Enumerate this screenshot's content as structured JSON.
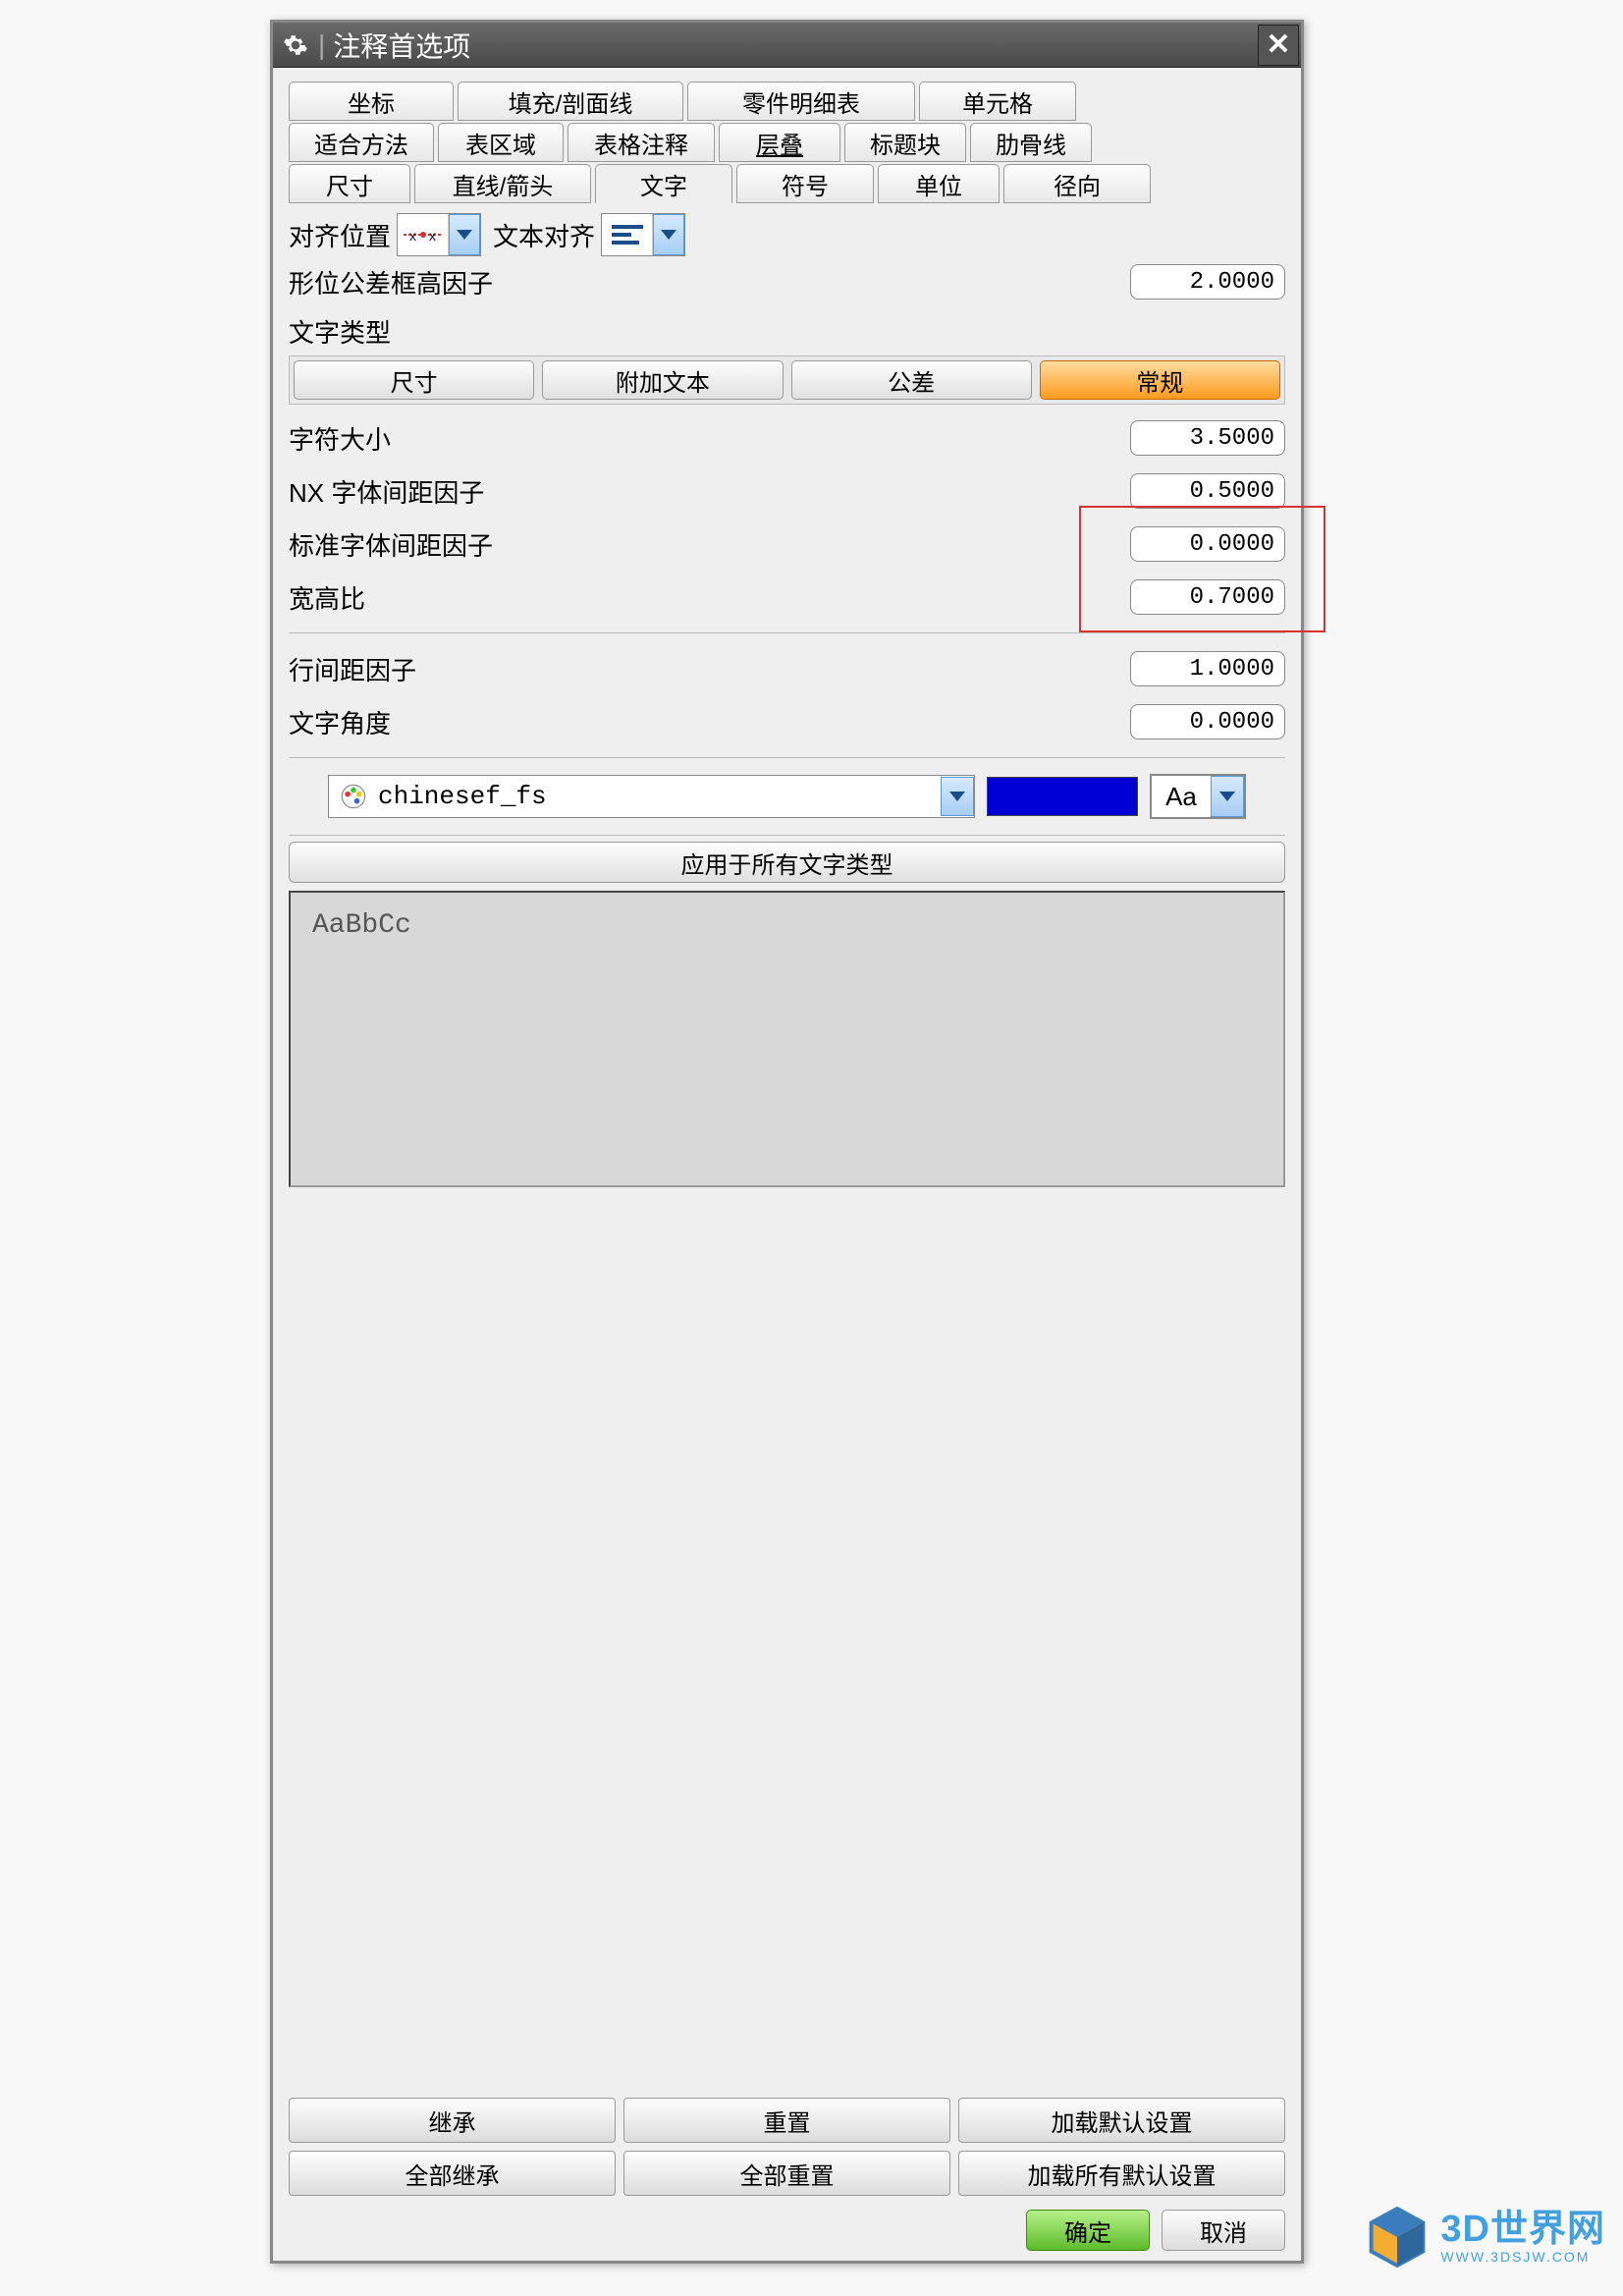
{
  "title": "注释首选项",
  "tabRows": [
    [
      {
        "id": "coord",
        "label": "坐标"
      },
      {
        "id": "fill-section",
        "label": "填充/剖面线"
      },
      {
        "id": "parts-list",
        "label": "零件明细表"
      },
      {
        "id": "cell",
        "label": "单元格"
      }
    ],
    [
      {
        "id": "fit-method",
        "label": "适合方法"
      },
      {
        "id": "table-area",
        "label": "表区域"
      },
      {
        "id": "table-annot",
        "label": "表格注释"
      },
      {
        "id": "overlay",
        "label": "层叠"
      },
      {
        "id": "title-block",
        "label": "标题块"
      },
      {
        "id": "rib-line",
        "label": "肋骨线"
      }
    ],
    [
      {
        "id": "dimension",
        "label": "尺寸"
      },
      {
        "id": "line-arrow",
        "label": "直线/箭头"
      },
      {
        "id": "text",
        "label": "文字",
        "active": true
      },
      {
        "id": "symbol",
        "label": "符号"
      },
      {
        "id": "unit",
        "label": "单位"
      },
      {
        "id": "radial",
        "label": "径向"
      }
    ]
  ],
  "alignPositionLabel": "对齐位置",
  "textAlignLabel": "文本对齐",
  "geomTolFrameLabel": "形位公差框高因子",
  "geomTolFrameValue": "2.0000",
  "textTypeLabel": "文字类型",
  "typeButtons": [
    {
      "id": "t-dimension",
      "label": "尺寸"
    },
    {
      "id": "t-appended",
      "label": "附加文本"
    },
    {
      "id": "t-tolerance",
      "label": "公差"
    },
    {
      "id": "t-general",
      "label": "常规",
      "active": true
    }
  ],
  "params": [
    {
      "id": "char-size",
      "label": "字符大小",
      "value": "3.5000"
    },
    {
      "id": "nx-spacing",
      "label": "NX 字体间距因子",
      "value": "0.5000"
    },
    {
      "id": "std-spacing",
      "label": "标准字体间距因子",
      "value": "0.0000"
    },
    {
      "id": "aspect",
      "label": "宽高比",
      "value": "0.7000"
    },
    {
      "id": "line-spacing",
      "label": "行间距因子",
      "value": "1.0000"
    },
    {
      "id": "text-angle",
      "label": "文字角度",
      "value": "0.0000"
    }
  ],
  "fontName": "chinesef_fs",
  "aaLabel": "Aa",
  "colorHex": "#0000d4",
  "applyAllLabel": "应用于所有文字类型",
  "previewText": "AaBbCc",
  "bottomButtons": [
    {
      "id": "inherit",
      "label": "继承"
    },
    {
      "id": "reset",
      "label": "重置"
    },
    {
      "id": "load-default",
      "label": "加载默认设置"
    },
    {
      "id": "inherit-all",
      "label": "全部继承"
    },
    {
      "id": "reset-all",
      "label": "全部重置"
    },
    {
      "id": "load-all-default",
      "label": "加载所有默认设置"
    }
  ],
  "okLabel": "确定",
  "cancelLabel": "取消",
  "watermark": {
    "main": "3D世界网",
    "sub": "WWW.3DSJW.COM"
  }
}
